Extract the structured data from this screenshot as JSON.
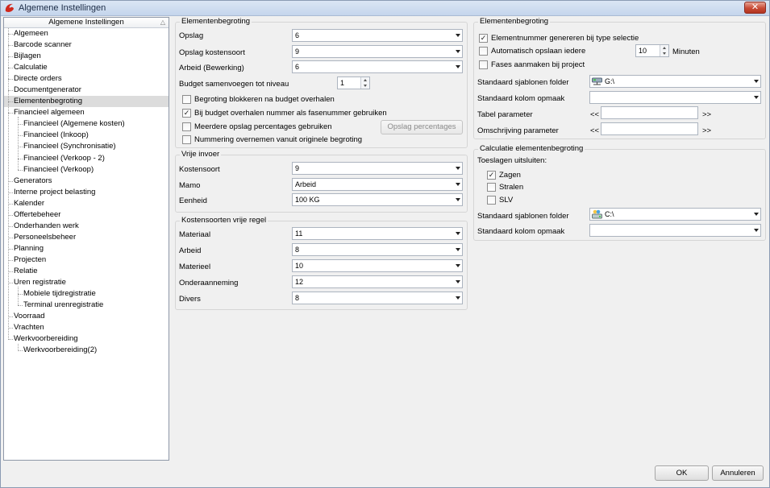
{
  "window": {
    "title": "Algemene Instellingen",
    "close_label": "✕"
  },
  "tree": {
    "header": "Algemene Instellingen",
    "items": [
      {
        "label": "Algemeen",
        "level": 0
      },
      {
        "label": "Barcode scanner",
        "level": 0
      },
      {
        "label": "Bijlagen",
        "level": 0
      },
      {
        "label": "Calculatie",
        "level": 0
      },
      {
        "label": "Directe orders",
        "level": 0
      },
      {
        "label": "Documentgenerator",
        "level": 0
      },
      {
        "label": "Elementenbegroting",
        "level": 0,
        "selected": true
      },
      {
        "label": "Financieel algemeen",
        "level": 0,
        "parent": true
      },
      {
        "label": "Financieel (Algemene kosten)",
        "level": 1
      },
      {
        "label": "Financieel (Inkoop)",
        "level": 1
      },
      {
        "label": "Financieel (Synchronisatie)",
        "level": 1
      },
      {
        "label": "Financieel (Verkoop - 2)",
        "level": 1
      },
      {
        "label": "Financieel (Verkoop)",
        "level": 1
      },
      {
        "label": "Generators",
        "level": 0
      },
      {
        "label": "Interne project belasting",
        "level": 0
      },
      {
        "label": "Kalender",
        "level": 0
      },
      {
        "label": "Offertebeheer",
        "level": 0
      },
      {
        "label": "Onderhanden werk",
        "level": 0
      },
      {
        "label": "Personeelsbeheer",
        "level": 0
      },
      {
        "label": "Planning",
        "level": 0
      },
      {
        "label": "Projecten",
        "level": 0
      },
      {
        "label": "Relatie",
        "level": 0
      },
      {
        "label": "Uren registratie",
        "level": 0,
        "parent": true
      },
      {
        "label": "Mobiele tijdregistratie",
        "level": 1
      },
      {
        "label": "Terminal urenregistratie",
        "level": 1
      },
      {
        "label": "Voorraad",
        "level": 0
      },
      {
        "label": "Vrachten",
        "level": 0
      },
      {
        "label": "Werkvoorbereiding",
        "level": 0,
        "parent": true
      },
      {
        "label": "Werkvoorbereiding(2)",
        "level": 1
      }
    ]
  },
  "elementen": {
    "title": "Elementenbegroting",
    "opslag_label": "Opslag",
    "opslag_value": "6",
    "opslag_kostensoort_label": "Opslag kostensoort",
    "opslag_kostensoort_value": "9",
    "arbeid_label": "Arbeid (Bewerking)",
    "arbeid_value": "6",
    "budget_niveau_label": "Budget samenvoegen tot niveau",
    "budget_niveau_value": "1",
    "cb_blokkeren": {
      "label": "Begroting blokkeren na budget overhalen",
      "checked": false
    },
    "cb_fasenummer": {
      "label": "Bij budget overhalen nummer als fasenummer gebruiken",
      "checked": true
    },
    "cb_meerdere": {
      "label": "Meerdere opslag percentages gebruiken",
      "checked": false
    },
    "cb_nummering": {
      "label": "Nummering overnemen vanuit originele begroting",
      "checked": false
    },
    "opslag_percentages_button": "Opslag percentages"
  },
  "vrije_invoer": {
    "title": "Vrije invoer",
    "kostensoort_label": "Kostensoort",
    "kostensoort_value": "9",
    "mamo_label": "Mamo",
    "mamo_value": "Arbeid",
    "eenheid_label": "Eenheid",
    "eenheid_value": "100 KG"
  },
  "kostensoorten": {
    "title": "Kostensoorten vrije regel",
    "materiaal_label": "Materiaal",
    "materiaal_value": "11",
    "arbeid_label": "Arbeid",
    "arbeid_value": "8",
    "materieel_label": "Materieel",
    "materieel_value": "10",
    "onderaanneming_label": "Onderaanneming",
    "onderaanneming_value": "12",
    "divers_label": "Divers",
    "divers_value": "8"
  },
  "right_elementen": {
    "title": "Elementenbegroting",
    "cb_elementnummer": {
      "label": "Elementnummer genereren bij type selectie",
      "checked": true
    },
    "cb_autosave": {
      "label": "Automatisch opslaan iedere",
      "checked": false
    },
    "autosave_value": "10",
    "autosave_unit": "Minuten",
    "cb_fases": {
      "label": "Fases aanmaken bij project",
      "checked": false
    },
    "sjablonen_label": "Standaard sjablonen folder",
    "sjablonen_value": "G:\\",
    "kolom_label": "Standaard kolom opmaak",
    "kolom_value": "",
    "tabel_label": "Tabel parameter",
    "omschrijving_label": "Omschrijving parameter",
    "ltlt": "<<",
    "gtgt": ">>"
  },
  "calculatie": {
    "title": "Calculatie elementenbegroting",
    "toeslagen_label": "Toeslagen uitsluiten:",
    "cb_zagen": {
      "label": "Zagen",
      "checked": true
    },
    "cb_stralen": {
      "label": "Stralen",
      "checked": false
    },
    "cb_slv": {
      "label": "SLV",
      "checked": false
    },
    "sjablonen_label": "Standaard sjablonen folder",
    "sjablonen_value": "C:\\",
    "kolom_label": "Standaard kolom opmaak",
    "kolom_value": ""
  },
  "footer": {
    "ok_label": "OK",
    "cancel_label": "Annuleren"
  },
  "colors": {
    "accent": "#c84a35",
    "selection": "#dcdcdc"
  }
}
